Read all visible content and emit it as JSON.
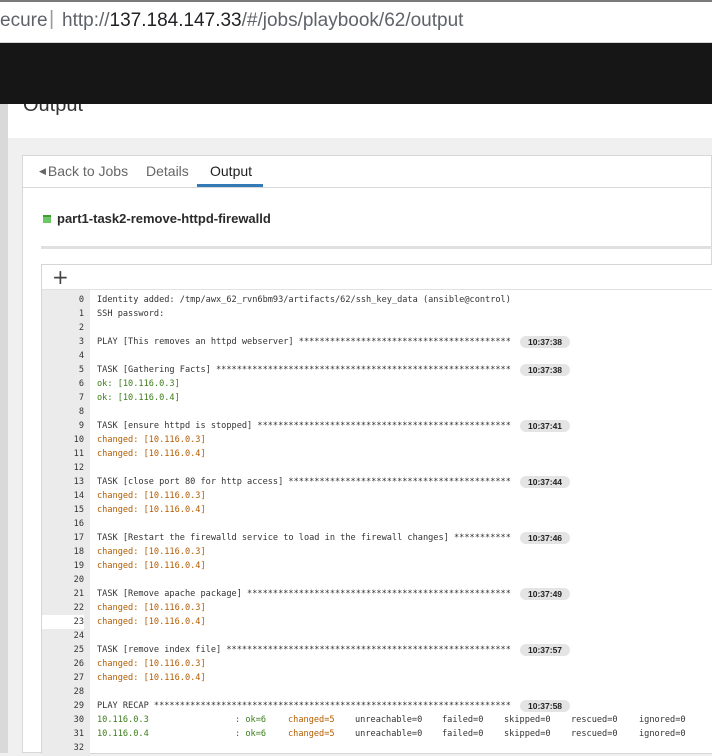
{
  "browser": {
    "security_label": "ecure",
    "separator": "|",
    "url_scheme": "http://",
    "url_host": "137.184.147.33",
    "url_path": "/#/jobs/playbook/62/output"
  },
  "page": {
    "title": "Output"
  },
  "tabs": {
    "back_label": "Back to Jobs",
    "details_label": "Details",
    "output_label": "Output"
  },
  "job": {
    "name": "part1-task2-remove-httpd-firewalld",
    "status": "successful"
  },
  "output": {
    "expand_label": "+",
    "lines": [
      {
        "n": "0",
        "text": "Identity added: /tmp/awx_62_rvn6bm93/artifacts/62/ssh_key_data (ansible@control)",
        "style": "",
        "time": ""
      },
      {
        "n": "1",
        "text": "SSH password:",
        "style": "",
        "time": ""
      },
      {
        "n": "2",
        "text": "",
        "style": "",
        "time": ""
      },
      {
        "n": "3",
        "text": "PLAY [This removes an httpd webserver] *****************************************",
        "style": "",
        "time": "10:37:38"
      },
      {
        "n": "4",
        "text": "",
        "style": "",
        "time": ""
      },
      {
        "n": "5",
        "text": "TASK [Gathering Facts] *********************************************************",
        "style": "",
        "time": "10:37:38"
      },
      {
        "n": "6",
        "text": "ok: [10.116.0.3]",
        "style": "ok",
        "time": ""
      },
      {
        "n": "7",
        "text": "ok: [10.116.0.4]",
        "style": "ok",
        "time": ""
      },
      {
        "n": "8",
        "text": "",
        "style": "",
        "time": ""
      },
      {
        "n": "9",
        "text": "TASK [ensure httpd is stopped] *************************************************",
        "style": "",
        "time": "10:37:41"
      },
      {
        "n": "10",
        "text": "changed: [10.116.0.3]",
        "style": "changed",
        "time": ""
      },
      {
        "n": "11",
        "text": "changed: [10.116.0.4]",
        "style": "changed",
        "time": ""
      },
      {
        "n": "12",
        "text": "",
        "style": "",
        "time": ""
      },
      {
        "n": "13",
        "text": "TASK [close port 80 for http access] *******************************************",
        "style": "",
        "time": "10:37:44"
      },
      {
        "n": "14",
        "text": "changed: [10.116.0.3]",
        "style": "changed",
        "time": ""
      },
      {
        "n": "15",
        "text": "changed: [10.116.0.4]",
        "style": "changed",
        "time": ""
      },
      {
        "n": "16",
        "text": "",
        "style": "",
        "time": ""
      },
      {
        "n": "17",
        "text": "TASK [Restart the firewalld service to load in the firewall changes] ***********",
        "style": "",
        "time": "10:37:46"
      },
      {
        "n": "18",
        "text": "changed: [10.116.0.3]",
        "style": "changed",
        "time": ""
      },
      {
        "n": "19",
        "text": "changed: [10.116.0.4]",
        "style": "changed",
        "time": ""
      },
      {
        "n": "20",
        "text": "",
        "style": "",
        "time": ""
      },
      {
        "n": "21",
        "text": "TASK [Remove apache package] ***************************************************",
        "style": "",
        "time": "10:37:49"
      },
      {
        "n": "22",
        "text": "changed: [10.116.0.3]",
        "style": "changed",
        "time": ""
      },
      {
        "n": "23",
        "text": "changed: [10.116.0.4]",
        "style": "changed",
        "time": ""
      },
      {
        "n": "24",
        "text": "",
        "style": "",
        "time": ""
      },
      {
        "n": "25",
        "text": "TASK [remove index file] *******************************************************",
        "style": "",
        "time": "10:37:57"
      },
      {
        "n": "26",
        "text": "changed: [10.116.0.3]",
        "style": "changed",
        "time": ""
      },
      {
        "n": "27",
        "text": "changed: [10.116.0.4]",
        "style": "changed",
        "time": ""
      },
      {
        "n": "28",
        "text": "",
        "style": "",
        "time": ""
      },
      {
        "n": "29",
        "text": "PLAY RECAP *********************************************************************",
        "style": "",
        "time": "10:37:58"
      },
      {
        "n": "30",
        "text": "",
        "style": "recap",
        "time": ""
      },
      {
        "n": "31",
        "text": "",
        "style": "recap",
        "time": ""
      },
      {
        "n": "32",
        "text": "",
        "style": "",
        "time": ""
      }
    ],
    "active_line": "23",
    "recap": [
      {
        "host": "10.116.0.3",
        "ok": ": ok=6",
        "changed": "changed=5",
        "unreachable": "unreachable=0",
        "failed": "failed=0",
        "skipped": "skipped=0",
        "rescued": "rescued=0",
        "ignored": "ignored=0"
      },
      {
        "host": "10.116.0.4",
        "ok": ": ok=6",
        "changed": "changed=5",
        "unreachable": "unreachable=0",
        "failed": "failed=0",
        "skipped": "skipped=0",
        "rescued": "rescued=0",
        "ignored": "ignored=0"
      }
    ]
  }
}
